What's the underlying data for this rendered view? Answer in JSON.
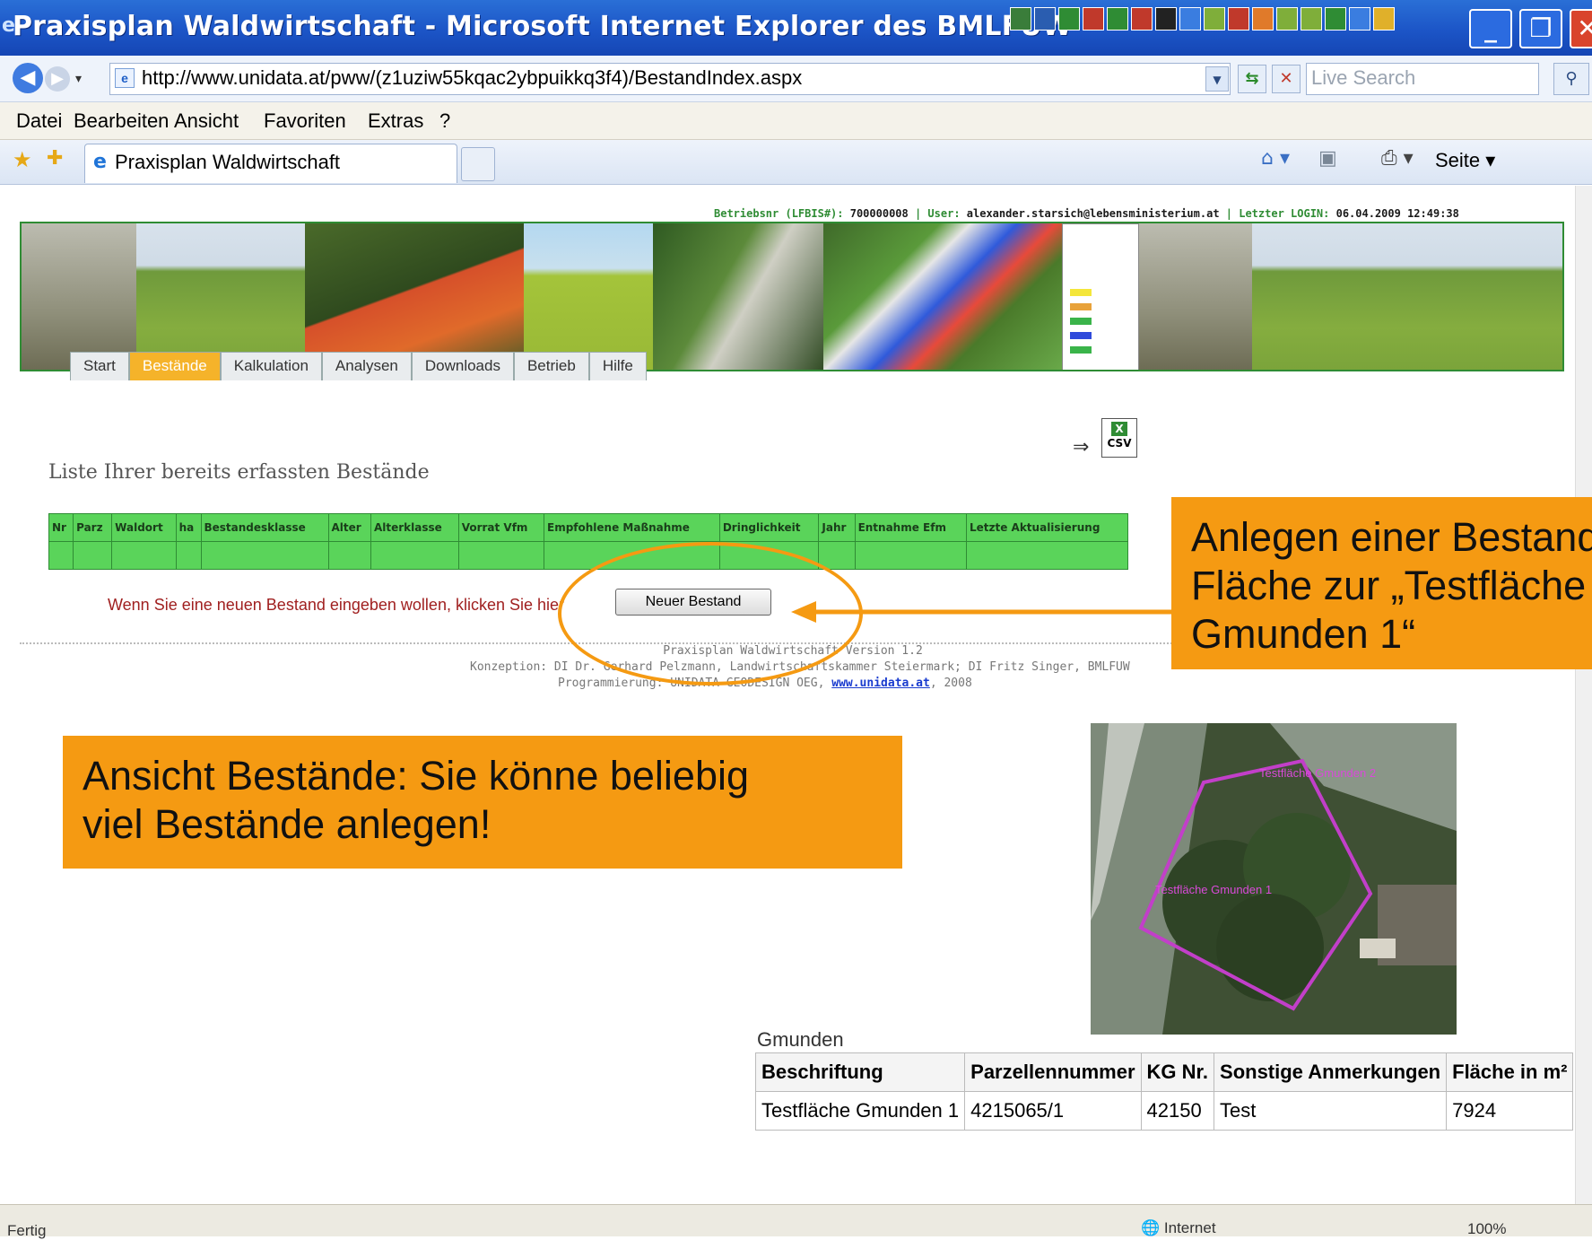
{
  "window": {
    "title": "Praxisplan Waldwirtschaft - Microsoft Internet Explorer des BMLFUW",
    "minimize": "_",
    "maximize": "❐",
    "close": "✕"
  },
  "address_bar": {
    "url": "http://www.unidata.at/pww/(z1uziw55kqac2ybpuikkq3f4)/BestandIndex.aspx",
    "search_placeholder": "Live Search"
  },
  "menu": [
    "Datei",
    "Bearbeiten",
    "Ansicht",
    "Favoriten",
    "Extras",
    "?"
  ],
  "tabs": {
    "active_label": "Praxisplan Waldwirtschaft"
  },
  "toolbar": {
    "page_menu": "Seite ▾"
  },
  "header": {
    "betrieb_label": "Betriebsnr (LFBIS#): ",
    "betrieb_nr": "700000008",
    "user_label": " | User: ",
    "user": "alexander.starsich@lebensministerium.at",
    "login_label": " | Letzter LOGIN: ",
    "login": "06.04.2009 12:49:38"
  },
  "nav": {
    "items": [
      "Start",
      "Bestände",
      "Kalkulation",
      "Analysen",
      "Downloads",
      "Betrieb",
      "Hilfe"
    ],
    "active": "Bestände"
  },
  "csv_export": {
    "label": "CSV",
    "arrow": "⇒"
  },
  "list": {
    "title": "Liste Ihrer bereits erfassten Bestände",
    "columns": [
      "Nr",
      "Parz",
      "Waldort",
      "ha",
      "Bestandesklasse",
      "Alter",
      "Alterklasse",
      "Vorrat Vfm",
      "Empfohlene Maßnahme",
      "Dringlichkeit",
      "Jahr",
      "Entnahme Efm",
      "Letzte Aktualisierung"
    ]
  },
  "new_stand": {
    "hint": "Wenn Sie eine neuen Bestand eingeben wollen, klicken Sie hier",
    "button": "Neuer Bestand"
  },
  "footer": {
    "line1": "Praxisplan Waldwirtschaft Version 1.2",
    "line2": "Konzeption: DI Dr. Gerhard Pelzmann, Landwirtschaftskammer Steiermark; DI Fritz Singer, BMLFUW",
    "line3_prefix": "Programmierung: UNIDATA GEODESIGN OEG, ",
    "line3_link": "www.unidata.at",
    "line3_suffix": ", 2008"
  },
  "callouts": {
    "right_line1": "Anlegen einer Bestands-",
    "right_line2": "Fläche zur „Testfläche",
    "right_line3": "Gmunden 1“",
    "left_line1": "Ansicht Bestände: Sie könne beliebig",
    "left_line2": "viel Bestände anlegen!"
  },
  "aerial": {
    "label1": "Testfläche Gmunden 2",
    "label2": "Testfläche Gmunden 1"
  },
  "parcel_info": {
    "caption": "Gmunden",
    "columns": [
      "Beschriftung",
      "Parzellennummer",
      "KG Nr.",
      "Sonstige Anmerkungen",
      "Fläche in m²"
    ],
    "rows": [
      [
        "Testfläche Gmunden 1",
        "4215065/1",
        "42150",
        "Test",
        "7924"
      ]
    ]
  },
  "statusbar": {
    "status": "Fertig",
    "zone": "Internet",
    "zoom": "100%"
  },
  "colors": {
    "accent_orange": "#f59a12",
    "table_green": "#5ad45a",
    "nav_active": "#f5b32a",
    "border_green": "#2f8c34"
  }
}
